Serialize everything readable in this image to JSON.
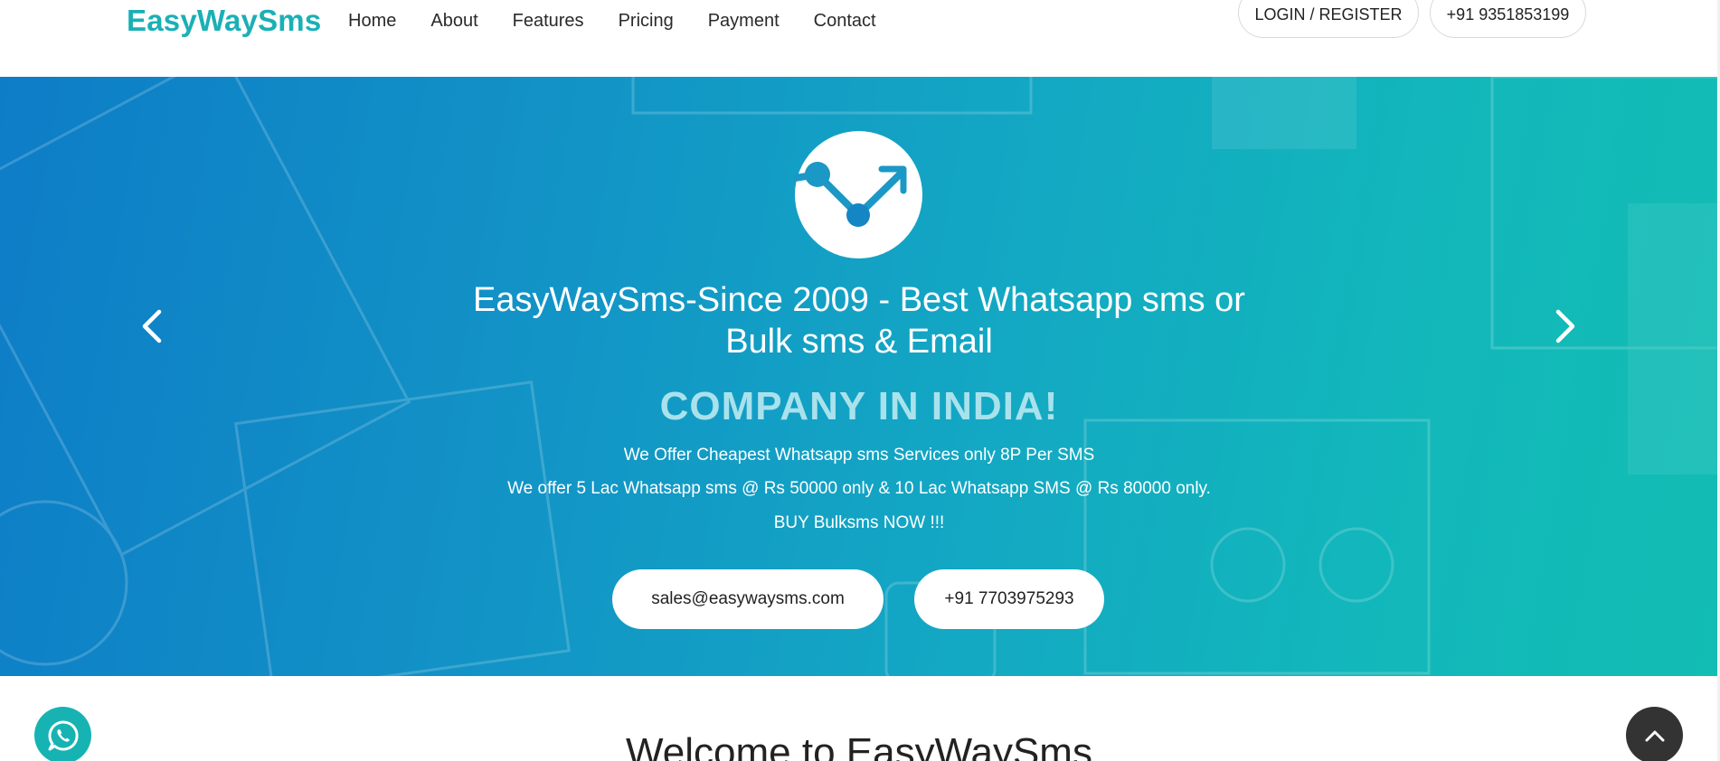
{
  "header": {
    "logo": "EasyWaySms",
    "nav": [
      "Home",
      "About",
      "Features",
      "Pricing",
      "Payment",
      "Contact"
    ],
    "login_label": "LOGIN / REGISTER",
    "phone_label": "+91 9351853199"
  },
  "hero": {
    "title_line1": "EasyWaySms-Since 2009 - Best Whatsapp sms or",
    "title_line2": "Bulk sms & Email",
    "subtitle": "COMPANY IN INDIA!",
    "line1": "We Offer Cheapest Whatsapp sms Services only 8P Per SMS",
    "line2": "We offer 5 Lac Whatsapp sms @ Rs 50000 only & 10 Lac Whatsapp SMS @ Rs 80000 only.",
    "line3": "BUY Bulksms NOW !!!",
    "email_button": "sales@easywaysms.com",
    "phone_button": "+91 7703975293",
    "prev_icon": "chevron-left-icon",
    "next_icon": "chevron-right-icon",
    "logo_icon": "trend-up-icon"
  },
  "welcome": {
    "heading": "Welcome to EasyWaySms"
  },
  "floating": {
    "whatsapp_icon": "whatsapp-icon",
    "back_to_top_icon": "chevron-up-icon"
  },
  "colors": {
    "brand": "#1ab0b5",
    "hero_start": "#0d7dc7",
    "hero_end": "#12bdb3",
    "subtitle": "#a9e2ec",
    "top_button": "#333333"
  }
}
